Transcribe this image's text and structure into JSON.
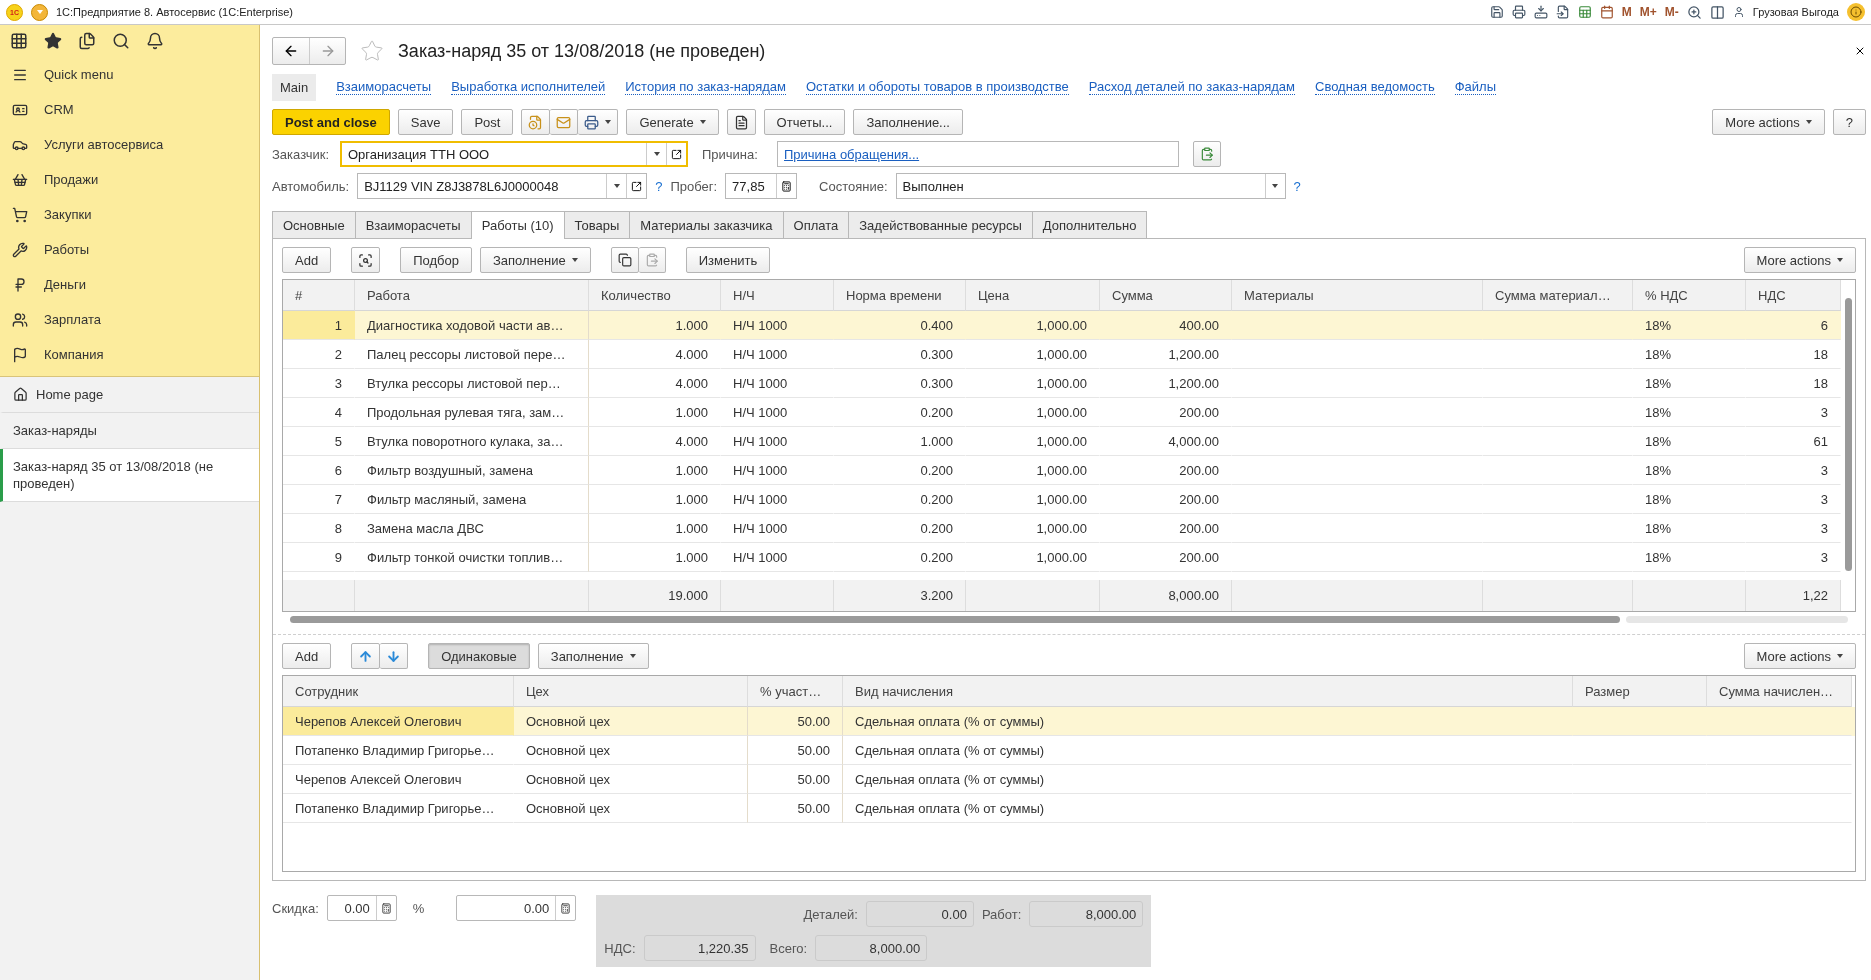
{
  "title_bar": {
    "logo": "1С",
    "title": "1С:Предприятие 8. Автосервис (1С:Enterprise)",
    "memory": [
      "M",
      "M+",
      "M-"
    ],
    "user": "Грузовая Выгода"
  },
  "sidebar": {
    "sections": [
      {
        "label": "Quick menu"
      },
      {
        "label": "CRM"
      },
      {
        "label": "Услуги автосервиса"
      },
      {
        "label": "Продажи"
      },
      {
        "label": "Закупки"
      },
      {
        "label": "Работы"
      },
      {
        "label": "Деньги"
      },
      {
        "label": "Зарплата"
      },
      {
        "label": "Компания"
      }
    ],
    "open_items": [
      {
        "label": "Home page",
        "selected": false
      },
      {
        "label": "Заказ-наряды",
        "selected": false
      },
      {
        "label": "Заказ-наряд 35 от 13/08/2018 (не проведен)",
        "selected": true
      }
    ]
  },
  "document": {
    "title": "Заказ-наряд 35 от 13/08/2018 (не проведен)",
    "favorite": false,
    "nav": [
      {
        "label": "Main",
        "selected": true
      },
      {
        "label": "Взаиморасчеты",
        "selected": false
      },
      {
        "label": "Выработка исполнителей",
        "selected": false
      },
      {
        "label": "История по заказ-нарядам",
        "selected": false
      },
      {
        "label": "Остатки и обороты товаров в производстве",
        "selected": false
      },
      {
        "label": "Расход деталей по заказ-нарядам",
        "selected": false
      },
      {
        "label": "Сводная ведомость",
        "selected": false
      },
      {
        "label": "Файлы",
        "selected": false
      }
    ],
    "toolbar": {
      "post_and_close": "Post and close",
      "save": "Save",
      "post": "Post",
      "generate": "Generate",
      "reports": "Отчеты...",
      "fill": "Заполнение...",
      "more": "More actions",
      "help": "?"
    },
    "fields": {
      "customer": {
        "label": "Заказчик:",
        "value": "Организация ТТН ООО",
        "focused": true
      },
      "reason": {
        "label": "Причина:",
        "value": "Причина обращения..."
      },
      "car": {
        "label": "Автомобиль:",
        "value": "BJ1129 VIN Z8J3878L6J0000048",
        "help": "?"
      },
      "mileage": {
        "label": "Пробег:",
        "value": "77,85"
      },
      "state": {
        "label": "Состояние:",
        "value": "Выполнен",
        "help": "?"
      }
    },
    "tabs": [
      {
        "label": "Основные",
        "selected": false
      },
      {
        "label": "Взаиморасчеты",
        "selected": false
      },
      {
        "label": "Работы (10)",
        "selected": true
      },
      {
        "label": "Товары",
        "selected": false
      },
      {
        "label": "Материалы заказчика",
        "selected": false
      },
      {
        "label": "Оплата",
        "selected": false
      },
      {
        "label": "Задействованные ресурсы",
        "selected": false
      },
      {
        "label": "Дополнительно",
        "selected": false
      }
    ],
    "works": {
      "toolbar": {
        "add": "Add",
        "pick": "Подбор",
        "fill": "Заполнение",
        "change": "Изменить",
        "more": "More actions"
      },
      "columns": [
        "#",
        "Работа",
        "Количество",
        "Н/Ч",
        "Норма времени",
        "Цена",
        "Сумма",
        "Материалы",
        "Сумма материал…",
        "% НДС",
        "НДС"
      ],
      "rows": [
        {
          "selected": true,
          "cells": [
            "1",
            "Диагностика ходовой части ав…",
            "1.000",
            "Н/Ч 1000",
            "0.400",
            "1,000.00",
            "400.00",
            null,
            null,
            "18%",
            "6"
          ]
        },
        {
          "selected": false,
          "cells": [
            "2",
            "Палец рессоры листовой пере…",
            "4.000",
            "Н/Ч 1000",
            "0.300",
            "1,000.00",
            "1,200.00",
            null,
            null,
            "18%",
            "18"
          ]
        },
        {
          "selected": false,
          "cells": [
            "3",
            "Втулка рессоры листовой пер…",
            "4.000",
            "Н/Ч 1000",
            "0.300",
            "1,000.00",
            "1,200.00",
            null,
            null,
            "18%",
            "18"
          ]
        },
        {
          "selected": false,
          "cells": [
            "4",
            "Продольная рулевая тяга, зам…",
            "1.000",
            "Н/Ч 1000",
            "0.200",
            "1,000.00",
            "200.00",
            null,
            null,
            "18%",
            "3"
          ]
        },
        {
          "selected": false,
          "cells": [
            "5",
            "Втулка поворотного кулака, за…",
            "4.000",
            "Н/Ч 1000",
            "1.000",
            "1,000.00",
            "4,000.00",
            null,
            null,
            "18%",
            "61"
          ]
        },
        {
          "selected": false,
          "cells": [
            "6",
            "Фильтр воздушный, замена",
            "1.000",
            "Н/Ч 1000",
            "0.200",
            "1,000.00",
            "200.00",
            null,
            null,
            "18%",
            "3"
          ]
        },
        {
          "selected": false,
          "cells": [
            "7",
            "Фильтр масляный, замена",
            "1.000",
            "Н/Ч 1000",
            "0.200",
            "1,000.00",
            "200.00",
            null,
            null,
            "18%",
            "3"
          ]
        },
        {
          "selected": false,
          "cells": [
            "8",
            "Замена масла ДВС",
            "1.000",
            "Н/Ч 1000",
            "0.200",
            "1,000.00",
            "200.00",
            null,
            null,
            "18%",
            "3"
          ]
        },
        {
          "selected": false,
          "cells": [
            "9",
            "Фильтр тонкой очистки топлив…",
            "1.000",
            "Н/Ч 1000",
            "0.200",
            "1,000.00",
            "200.00",
            null,
            null,
            "18%",
            "3"
          ]
        }
      ],
      "totals": {
        "quantity": "19.000",
        "time_norm": "3.200",
        "sum": "8,000.00",
        "vat": "1,22"
      }
    },
    "employees": {
      "toolbar": {
        "add": "Add",
        "same": {
          "label": "Одинаковые",
          "pressed": true
        },
        "fill": "Заполнение",
        "more": "More actions"
      },
      "columns": [
        "Сотрудник",
        "Цех",
        "% участ…",
        "Вид начисления",
        "Размер",
        "Сумма начислен…"
      ],
      "rows": [
        {
          "selected": true,
          "cells": [
            "Черепов Алексей Олегович",
            "Основной цех",
            "50.00",
            "Сдельная оплата (% от суммы)",
            null,
            null
          ]
        },
        {
          "selected": false,
          "cells": [
            "Потапенко Владимир Григорье…",
            "Основной цех",
            "50.00",
            "Сдельная оплата (% от суммы)",
            null,
            null
          ]
        },
        {
          "selected": false,
          "cells": [
            "Черепов Алексей Олегович",
            "Основной цех",
            "50.00",
            "Сдельная оплата (% от суммы)",
            null,
            null
          ]
        },
        {
          "selected": false,
          "cells": [
            "Потапенко Владимир Григорье…",
            "Основной цех",
            "50.00",
            "Сдельная оплата (% от суммы)",
            null,
            null
          ]
        }
      ]
    },
    "footer": {
      "discount_label": "Скидка:",
      "discount_percent": "0.00",
      "percent_sign": "%",
      "discount_sum": "0.00",
      "parts_label": "Деталей:",
      "parts": "0.00",
      "works_label": "Работ:",
      "works": "8,000.00",
      "vat_label": "НДС:",
      "vat": "1,220.35",
      "total_label": "Всего:",
      "total": "8,000.00"
    }
  }
}
